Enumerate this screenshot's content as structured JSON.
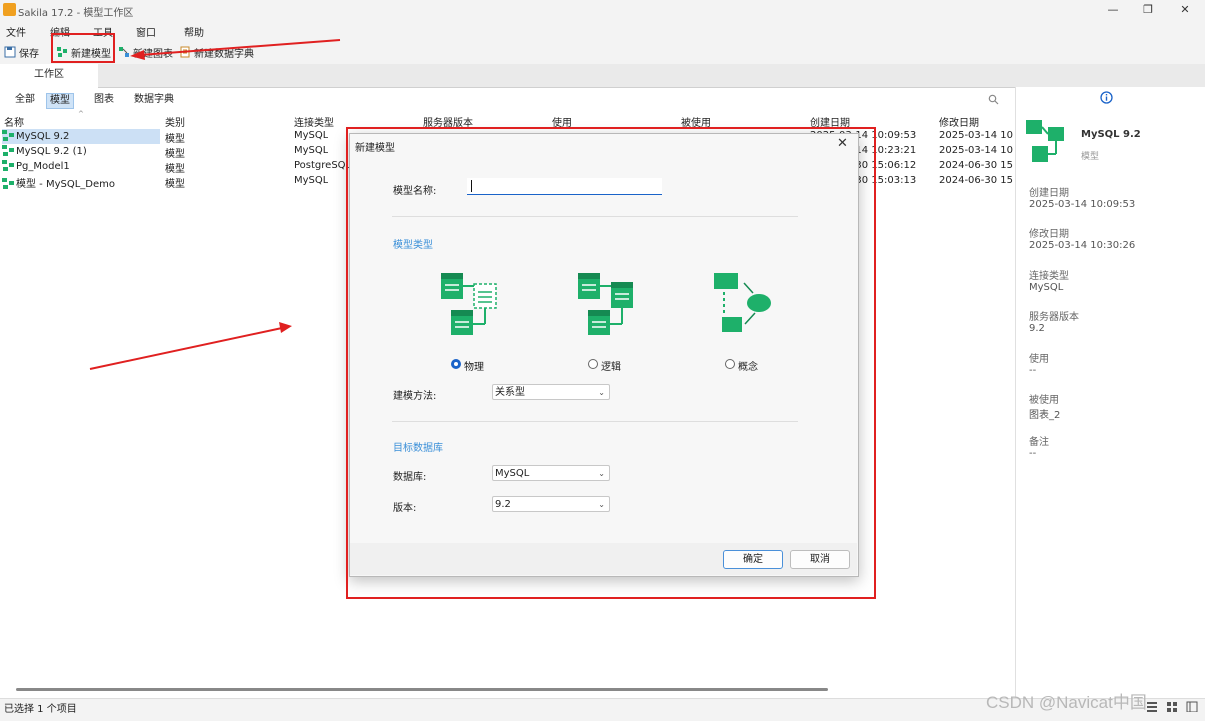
{
  "window": {
    "title": "Sakila 17.2 - 模型工作区",
    "minimize": "—",
    "maximize": "❐",
    "close": "✕"
  },
  "menu": [
    "文件",
    "编辑",
    "工具",
    "窗口",
    "帮助"
  ],
  "toolbar": {
    "save": "保存",
    "new_model": "新建模型",
    "new_diagram": "新建图表",
    "new_dictionary": "新建数据字典"
  },
  "tab": "工作区",
  "filters": [
    "全部",
    "模型",
    "图表",
    "数据字典"
  ],
  "columns": [
    "名称",
    "类别",
    "连接类型",
    "服务器版本",
    "使用",
    "被使用",
    "创建日期",
    "修改日期"
  ],
  "rows": [
    {
      "name": "MySQL 9.2",
      "category": "模型",
      "conn": "MySQL",
      "created": "2025-03-14 10:09:53",
      "modified": "2025-03-14 10:"
    },
    {
      "name": "MySQL 9.2 (1)",
      "category": "模型",
      "conn": "MySQL",
      "created": "2025-03-14 10:23:21",
      "modified": "2025-03-14 10:"
    },
    {
      "name": "Pg_Model1",
      "category": "模型",
      "conn": "PostgreSQL",
      "created": "2024-06-30 15:06:12",
      "modified": "2024-06-30 15:"
    },
    {
      "name": "模型 - MySQL_Demo",
      "category": "模型",
      "conn": "MySQL",
      "created": "2024-06-30 15:03:13",
      "modified": "2024-06-30 15:"
    }
  ],
  "status": "已选择 1 个项目",
  "watermark": "CSDN @Navicat中国",
  "panel": {
    "name": "MySQL 9.2",
    "type": "模型",
    "fields": [
      {
        "label": "创建日期",
        "value": "2025-03-14 10:09:53"
      },
      {
        "label": "修改日期",
        "value": "2025-03-14 10:30:26"
      },
      {
        "label": "连接类型",
        "value": "MySQL"
      },
      {
        "label": "服务器版本",
        "value": "9.2"
      },
      {
        "label": "使用",
        "value": "--"
      },
      {
        "label": "被使用",
        "value": "图表_2"
      },
      {
        "label": "备注",
        "value": "--"
      }
    ]
  },
  "dialog": {
    "title": "新建模型",
    "name_label": "模型名称:",
    "name_value": "",
    "type_section": "模型类型",
    "types": [
      "物理",
      "逻辑",
      "概念"
    ],
    "selected_type": "物理",
    "method_label": "建模方法:",
    "method_value": "关系型",
    "target_section": "目标数据库",
    "db_label": "数据库:",
    "db_value": "MySQL",
    "version_label": "版本:",
    "version_value": "9.2",
    "ok": "确定",
    "cancel": "取消"
  },
  "colors": {
    "accent": "#3a8fd8",
    "annotation": "#e02020",
    "icon_green": "#1eb06a"
  }
}
